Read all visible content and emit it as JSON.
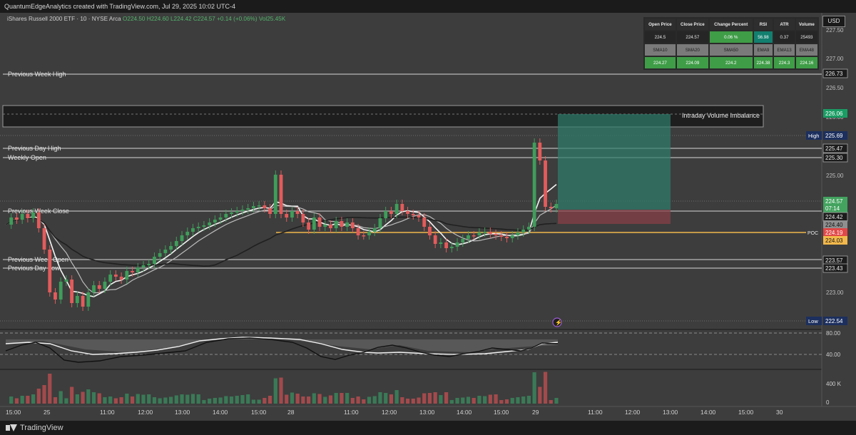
{
  "attribution": "QuantumEdgeAnalytics created with TradingView.com, Jul 29, 2025 10:02 UTC-4",
  "legend": {
    "symbol": "iShares Russell 2000 ETF · 10 · NYSE Arca",
    "o": "O224.50",
    "h": "H224.60",
    "l": "L224.42",
    "c": "C224.57",
    "change": "+0.14 (+0.06%)",
    "vol": "Vol25.45K"
  },
  "currency": "USD",
  "stats": {
    "headers1": [
      "Open Price",
      "Close Price",
      "Change Percent",
      "RSI",
      "ATR",
      "Volume"
    ],
    "values1": [
      "224.5",
      "224.57",
      "0.06 %",
      "56.98",
      "0.37",
      "25493"
    ],
    "headers2": [
      "SMA10",
      "SMA20",
      "SMA50",
      "EMA9",
      "EMA13",
      "EMA48"
    ],
    "values2": [
      "224.27",
      "224.09",
      "224.2",
      "224.38",
      "224.3",
      "224.16"
    ]
  },
  "levels": {
    "prev_week_high": "Previous Week High",
    "prev_day_high": "Previous Day High",
    "weekly_open": "Weekly Open",
    "prev_week_close": "Previous Week Close",
    "prev_week_open": "Previous Week Open",
    "prev_day_low": "Previous Day Low",
    "imbalance": "Intraday Volume Imbalance",
    "poc": "POC"
  },
  "price_axis": {
    "ticks": [
      "227.50",
      "227.00",
      "226.50",
      "226.00",
      "225.50",
      "225.00",
      "224.50",
      "224.00",
      "223.50",
      "223.00"
    ],
    "labels": {
      "pwh": "226.73",
      "imb": "226.06",
      "high_tag": "High",
      "high": "225.69",
      "pdh": "225.47",
      "wo": "225.30",
      "last": "224.57",
      "countdown": "07:14",
      "pwc": "224.42",
      "p2": "224.40",
      "poc": "224.19",
      "p3": "224.03",
      "pwo": "223.57",
      "pdl": "223.43",
      "low_tag": "Low",
      "low": "222.54"
    }
  },
  "rsi_axis": [
    "80.00",
    "40.00"
  ],
  "volume_axis": [
    "400 K",
    "0"
  ],
  "time_axis": [
    "15:00",
    "25",
    "11:00",
    "12:00",
    "13:00",
    "14:00",
    "15:00",
    "28",
    "11:00",
    "12:00",
    "13:00",
    "14:00",
    "15:00",
    "29",
    "11:00",
    "12:00",
    "13:00",
    "14:00",
    "15:00",
    "30"
  ],
  "footer": "TradingView",
  "colors": {
    "up": "#3f9d5a",
    "down": "#e35b5b",
    "poc": "#f2b84b",
    "accent": "#2962ff",
    "panel": "#3d3d3d"
  }
}
